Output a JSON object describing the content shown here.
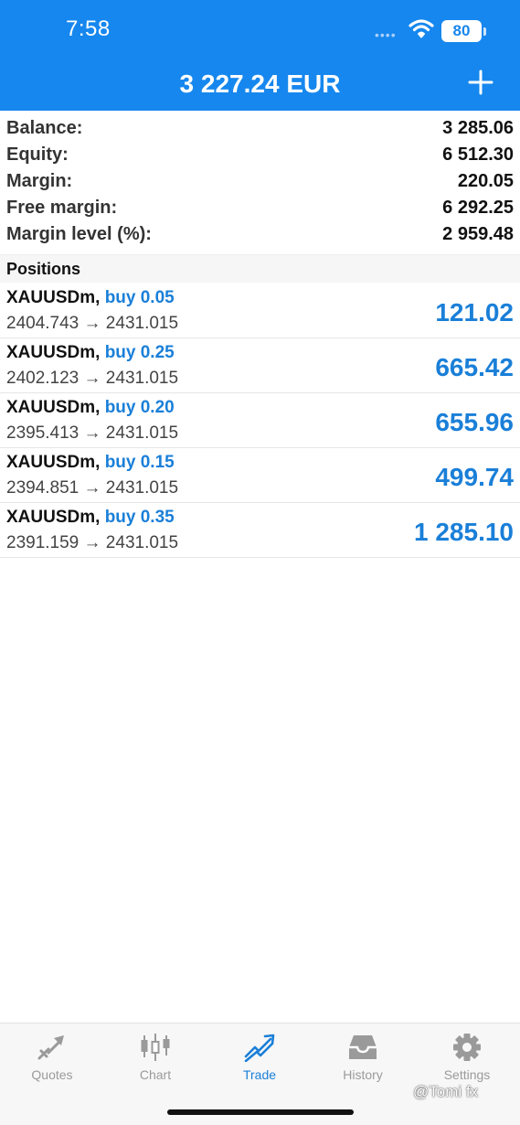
{
  "status_bar": {
    "time": "7:58",
    "battery": "80"
  },
  "header": {
    "title": "3 227.24 EUR",
    "add_icon": "plus-icon"
  },
  "summary": [
    {
      "label": "Balance:",
      "value": "3 285.06"
    },
    {
      "label": "Equity:",
      "value": "6 512.30"
    },
    {
      "label": "Margin:",
      "value": "220.05"
    },
    {
      "label": "Free margin:",
      "value": "6 292.25"
    },
    {
      "label": "Margin level (%):",
      "value": "2 959.48"
    }
  ],
  "positions_header": "Positions",
  "positions": [
    {
      "symbol": "XAUUSDm,",
      "direction": "buy 0.05",
      "prices": "2404.743 → 2431.015",
      "profit": "121.02"
    },
    {
      "symbol": "XAUUSDm,",
      "direction": "buy 0.25",
      "prices": "2402.123 → 2431.015",
      "profit": "665.42"
    },
    {
      "symbol": "XAUUSDm,",
      "direction": "buy 0.20",
      "prices": "2395.413 → 2431.015",
      "profit": "655.96"
    },
    {
      "symbol": "XAUUSDm,",
      "direction": "buy 0.15",
      "prices": "2394.851 → 2431.015",
      "profit": "499.74"
    },
    {
      "symbol": "XAUUSDm,",
      "direction": "buy 0.35",
      "prices": "2391.159 → 2431.015",
      "profit": "1 285.10"
    }
  ],
  "tabs": [
    {
      "label": "Quotes",
      "icon": "quotes-arrow-icon"
    },
    {
      "label": "Chart",
      "icon": "candlestick-icon"
    },
    {
      "label": "Trade",
      "icon": "trade-trend-icon"
    },
    {
      "label": "History",
      "icon": "inbox-tray-icon"
    },
    {
      "label": "Settings",
      "icon": "gear-icon"
    }
  ],
  "watermark": "@Tomi fx",
  "colors": {
    "header_bg": "#1687ee",
    "accent_blue": "#1a7fd8",
    "tab_inactive": "#9a9a9a"
  }
}
